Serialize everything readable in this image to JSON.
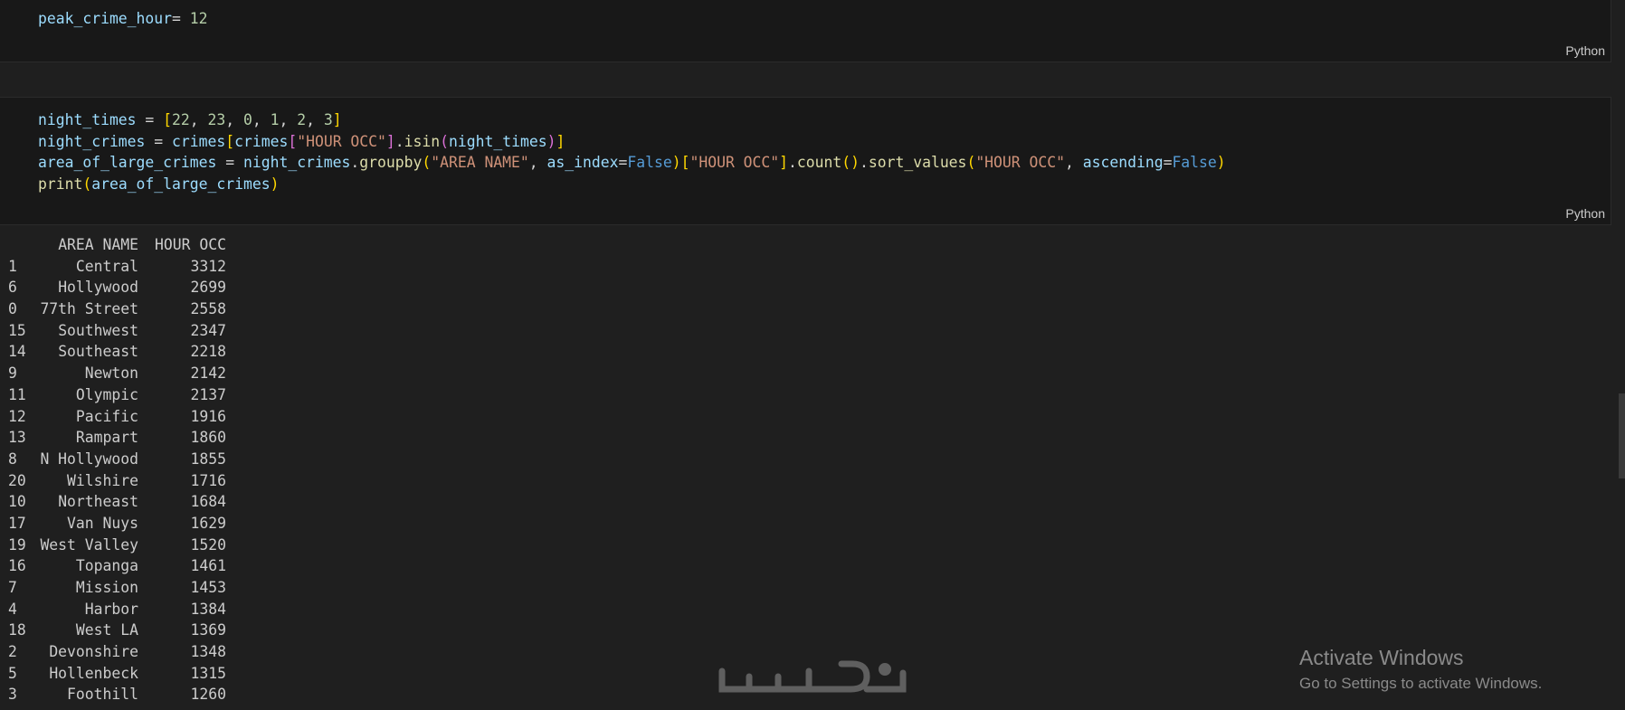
{
  "cells": [
    {
      "language": "Python",
      "lines": [
        [
          [
            "v",
            "peak_crime_hour"
          ],
          [
            "p",
            "= "
          ],
          [
            "n",
            "12"
          ]
        ]
      ]
    },
    {
      "language": "Python",
      "lines": [
        [
          [
            "v",
            "night_times"
          ],
          [
            "p",
            " = "
          ],
          [
            "b1",
            "["
          ],
          [
            "n",
            "22"
          ],
          [
            "p",
            ", "
          ],
          [
            "n",
            "23"
          ],
          [
            "p",
            ", "
          ],
          [
            "n",
            "0"
          ],
          [
            "p",
            ", "
          ],
          [
            "n",
            "1"
          ],
          [
            "p",
            ", "
          ],
          [
            "n",
            "2"
          ],
          [
            "p",
            ", "
          ],
          [
            "n",
            "3"
          ],
          [
            "b1",
            "]"
          ]
        ],
        [
          [
            "v",
            "night_crimes"
          ],
          [
            "p",
            " = "
          ],
          [
            "v",
            "crimes"
          ],
          [
            "b1",
            "["
          ],
          [
            "v",
            "crimes"
          ],
          [
            "b2",
            "["
          ],
          [
            "s",
            "\"HOUR OCC\""
          ],
          [
            "b2",
            "]"
          ],
          [
            "p",
            "."
          ],
          [
            "f",
            "isin"
          ],
          [
            "b2",
            "("
          ],
          [
            "v",
            "night_times"
          ],
          [
            "b2",
            ")"
          ],
          [
            "b1",
            "]"
          ]
        ],
        [
          [
            "v",
            "area_of_large_crimes"
          ],
          [
            "p",
            " = "
          ],
          [
            "v",
            "night_crimes"
          ],
          [
            "p",
            "."
          ],
          [
            "f",
            "groupby"
          ],
          [
            "b1",
            "("
          ],
          [
            "s",
            "\"AREA NAME\""
          ],
          [
            "p",
            ", "
          ],
          [
            "v",
            "as_index"
          ],
          [
            "p",
            "="
          ],
          [
            "k",
            "False"
          ],
          [
            "b1",
            ")"
          ],
          [
            "b1",
            "["
          ],
          [
            "s",
            "\"HOUR OCC\""
          ],
          [
            "b1",
            "]"
          ],
          [
            "p",
            "."
          ],
          [
            "f",
            "count"
          ],
          [
            "b1",
            "()"
          ],
          [
            "p",
            "."
          ],
          [
            "f",
            "sort_values"
          ],
          [
            "b1",
            "("
          ],
          [
            "s",
            "\"HOUR OCC\""
          ],
          [
            "p",
            ", "
          ],
          [
            "v",
            "ascending"
          ],
          [
            "p",
            "="
          ],
          [
            "k",
            "False"
          ],
          [
            "b1",
            ")"
          ]
        ],
        [
          [
            "f",
            "print"
          ],
          [
            "b1",
            "("
          ],
          [
            "v",
            "area_of_large_crimes"
          ],
          [
            "b1",
            ")"
          ]
        ]
      ]
    }
  ],
  "output": {
    "headers": [
      "",
      "AREA NAME",
      "HOUR OCC"
    ],
    "rows": [
      [
        "1",
        "Central",
        "3312"
      ],
      [
        "6",
        "Hollywood",
        "2699"
      ],
      [
        "0",
        "77th Street",
        "2558"
      ],
      [
        "15",
        "Southwest",
        "2347"
      ],
      [
        "14",
        "Southeast",
        "2218"
      ],
      [
        "9",
        "Newton",
        "2142"
      ],
      [
        "11",
        "Olympic",
        "2137"
      ],
      [
        "12",
        "Pacific",
        "1916"
      ],
      [
        "13",
        "Rampart",
        "1860"
      ],
      [
        "8",
        "N Hollywood",
        "1855"
      ],
      [
        "20",
        "Wilshire",
        "1716"
      ],
      [
        "10",
        "Northeast",
        "1684"
      ],
      [
        "17",
        "Van Nuys",
        "1629"
      ],
      [
        "19",
        "West Valley",
        "1520"
      ],
      [
        "16",
        "Topanga",
        "1461"
      ],
      [
        "7",
        "Mission",
        "1453"
      ],
      [
        "4",
        "Harbor",
        "1384"
      ],
      [
        "18",
        "West LA",
        "1369"
      ],
      [
        "2",
        "Devonshire",
        "1348"
      ],
      [
        "5",
        "Hollenbeck",
        "1315"
      ],
      [
        "3",
        "Foothill",
        "1260"
      ]
    ]
  },
  "watermark": {
    "text": "خدسات",
    "color": "#5f5f5f"
  },
  "activation_notice": {
    "title": "Activate Windows",
    "subtitle": "Go to Settings to activate Windows."
  }
}
